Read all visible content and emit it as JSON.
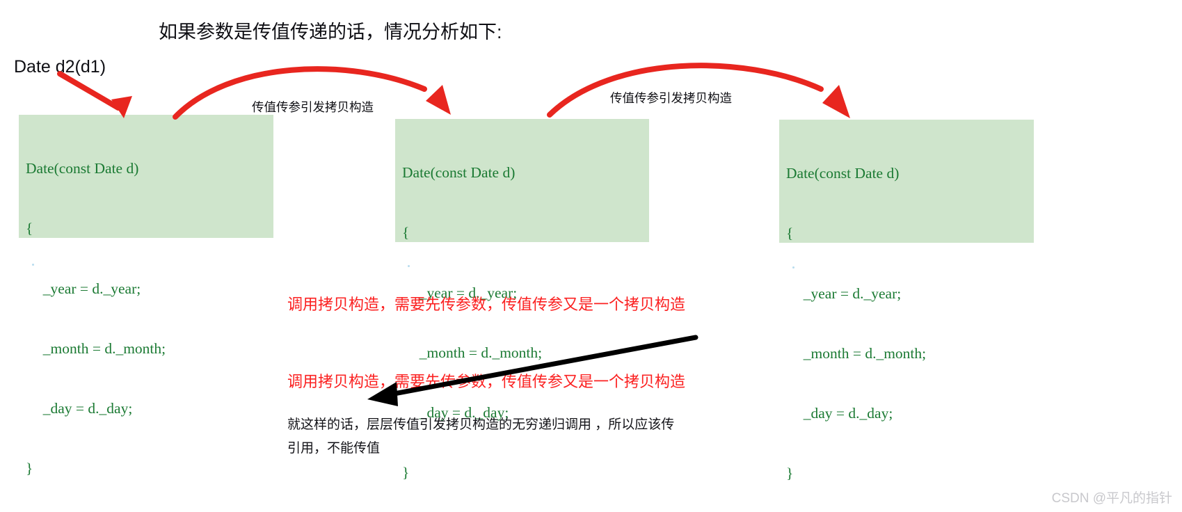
{
  "page": {
    "title": "如果参数是传值传递的话，情况分析如下:",
    "variable_label": "Date d2(d1)",
    "watermark": "CSDN @平凡的指针",
    "background_color": "#ffffff"
  },
  "colors": {
    "code_background": "#cfe5cc",
    "code_text": "#1b7a33",
    "arrow_red": "#e8261f",
    "arrow_black": "#000000",
    "note_red": "#fb2020",
    "note_black": "#131318",
    "watermark": "#c8c8cc"
  },
  "code_blocks": [
    {
      "id": "copy-constructor-1",
      "lines": [
        "Date(const Date d)",
        "{",
        "  _year = d._year;",
        "  _month = d._month;",
        "  _day = d._day;",
        "}"
      ]
    },
    {
      "id": "copy-constructor-2",
      "lines": [
        "Date(const Date d)",
        "{",
        "  _year = d._year;",
        "  _month = d._month;",
        "  _day = d._day;",
        "}"
      ]
    },
    {
      "id": "copy-constructor-3",
      "lines": [
        "Date(const Date d)",
        "{",
        "  _year = d._year;",
        "  _month = d._month;",
        "  _day = d._day;",
        "}"
      ]
    }
  ],
  "arrow_labels": [
    {
      "id": "label-1",
      "text": "传值传参引发拷贝构造"
    },
    {
      "id": "label-2",
      "text": "传值传参引发拷贝构造"
    }
  ],
  "notes": {
    "red_line_1": "调用拷贝构造，需要先传参数，传值传参又是一个拷贝构造",
    "red_line_2": "调用拷贝构造，需要先传参数，传值传参又是一个拷贝构造",
    "black_line_1": "就这样的话，层层传值引发拷贝构造的无穷递归调用 ，所以应该传",
    "black_line_2": "引用，不能传值"
  }
}
